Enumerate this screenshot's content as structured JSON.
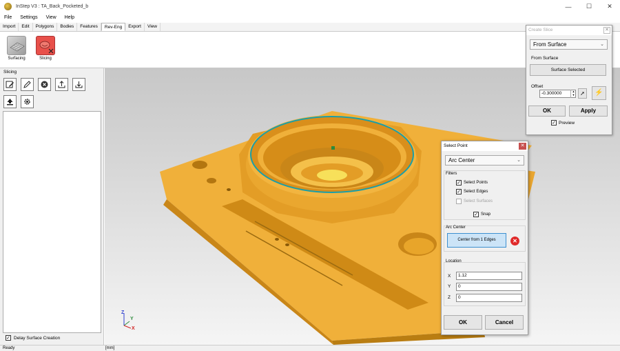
{
  "window": {
    "title": "InStep V3 : TA_Back_Pocketed_b",
    "controls": [
      "—",
      "☐",
      "✕"
    ]
  },
  "menu": [
    "File",
    "Settings",
    "View",
    "Help"
  ],
  "ribbon_tabs": [
    "Import",
    "Edit",
    "Polygons",
    "Bodies",
    "Features",
    "Rev-Eng",
    "Export",
    "View"
  ],
  "active_tab": "Rev-Eng",
  "ribbon": {
    "surfacing_label": "Surfacing",
    "slicing_label": "Slicing"
  },
  "left_panel": {
    "title": "Slicing",
    "tools_row1": [
      "edit-slice-icon",
      "pencil-icon",
      "delete-icon",
      "export-icon",
      "import-icon"
    ],
    "tools_row2": [
      "upload-icon",
      "settings-gear-icon"
    ],
    "delay_label": "Delay Surface Creation",
    "delay_checked": true
  },
  "status": {
    "left": "Ready",
    "units": "[mm]"
  },
  "create_slice": {
    "title": "Create Slice",
    "mode_value": "From Surface",
    "section_label": "From Surface",
    "surface_button": "Surface Selected",
    "offset_label": "Offset",
    "offset_value": "-0.300000",
    "ok": "OK",
    "apply": "Apply",
    "preview_label": "Preview",
    "preview_checked": true
  },
  "select_point": {
    "title": "Select Point",
    "mode_value": "Arc Center",
    "filters_label": "Filters",
    "select_points": "Select Points",
    "select_edges": "Select Edges",
    "select_surfaces": "Select Surfaces",
    "snap_label": "Snap",
    "arc_center_label": "Arc Center",
    "center_button": "Center from 1 Edges",
    "location_label": "Location",
    "x_label": "X",
    "x_value": "1.12",
    "y_label": "Y",
    "y_value": "0",
    "z_label": "Z",
    "z_value": "0",
    "ok": "OK",
    "cancel": "Cancel"
  },
  "axes": {
    "z": "Z",
    "y": "Y",
    "x": "X"
  },
  "colors": {
    "part": "#e8a52a",
    "part_dark": "#b97d12",
    "edge_highlight": "#1a9ea8"
  }
}
